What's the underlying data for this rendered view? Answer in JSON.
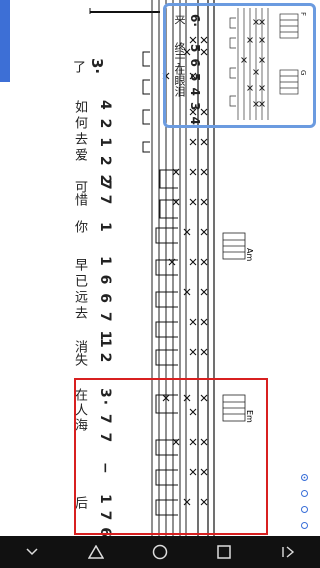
{
  "score": {
    "main_row": {
      "start": "3·",
      "lyric_start": "了",
      "measures": [
        {
          "notes": "4 2 1 2 2",
          "lyric": "如何去爱"
        },
        {
          "notes": "7 7",
          "lyric": "可惜"
        },
        {
          "notes": "1",
          "lyric": "你"
        },
        {
          "notes": "1 6 6 7 1",
          "lyric": "早已远去"
        },
        {
          "notes": "1 2",
          "lyric": "消失"
        },
        {
          "notes": "3· 7 7",
          "lyric": "在人海"
        },
        {
          "notes": "−",
          "lyric": ""
        },
        {
          "notes": "1 7 6",
          "lyric": "后"
        }
      ]
    },
    "top_row": {
      "lead": "6·",
      "lead_lyric": "来",
      "notes": "5 6 5 4 3 4",
      "lyric": "终于在眼泪"
    },
    "chords": [
      {
        "name": "F"
      },
      {
        "name": "G"
      },
      {
        "name": "Am"
      },
      {
        "name": "Em"
      }
    ]
  },
  "pager": {
    "pages": 4,
    "active": 1
  },
  "nav": {
    "back": "back",
    "home": "home",
    "recents": "recents",
    "menu": "menu"
  }
}
